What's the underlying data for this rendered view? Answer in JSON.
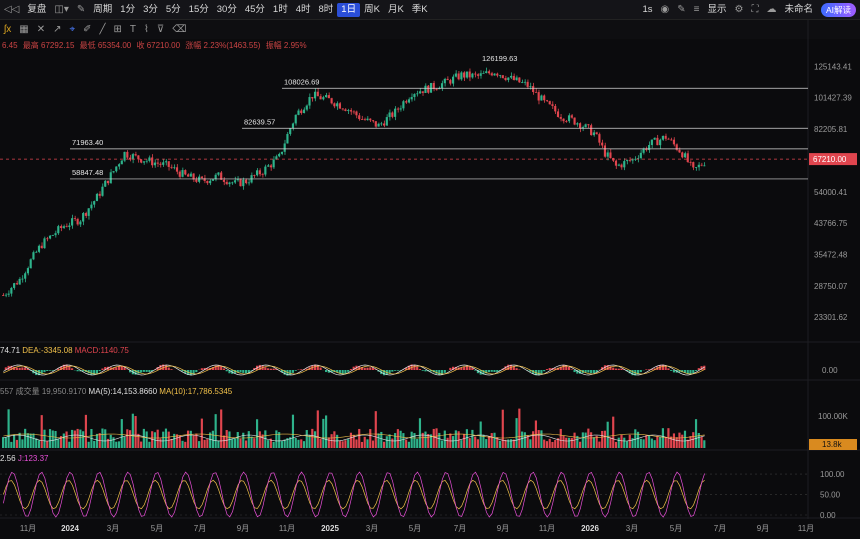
{
  "toolbar": {
    "items": [
      "复盘",
      "周期",
      "1分",
      "3分",
      "5分",
      "15分",
      "30分",
      "45分",
      "1时",
      "4时",
      "8时",
      "1日",
      "周K",
      "月K",
      "季K"
    ],
    "active": "1日",
    "right": {
      "interval": "1s",
      "display": "显示",
      "save": "未命名",
      "ai": "AI解读"
    }
  },
  "info": {
    "items": [
      "6.45",
      "最高 67292.15",
      "最低 65354.00",
      "收 67210.00",
      "涨幅 2.23%(1463.55)",
      "振幅 2.95%"
    ]
  },
  "macd_info": {
    "dif": "74.71",
    "dea": "DEA:-3345.08",
    "macd": "MACD:1140.75"
  },
  "vol_info": {
    "a": "557",
    "b": "成交量 19,950.9170",
    "ma5": "MA(5):14,153.8660",
    "ma10": "MA(10):17,786.5345"
  },
  "kdj_info": {
    "k": "2.56",
    "j": "J:123.37"
  },
  "colors": {
    "up": "#2eb38b",
    "down": "#e0454e",
    "k": "#f0c04a",
    "d": "#e84fd8",
    "price": "#e0454e"
  },
  "chart_data": {
    "type": "candlestick",
    "price_axis": [
      "125143.41",
      "101427.39",
      "82205.81",
      "67210.00",
      "54000.41",
      "43766.75",
      "35472.48",
      "28750.07",
      "23301.62"
    ],
    "last_price": "67210.00",
    "annotations": [
      {
        "label": "126199.63",
        "value": 126199.63
      },
      {
        "label": "108026.69",
        "value": 108026.69
      },
      {
        "label": "82639.57",
        "value": 82639.57
      },
      {
        "label": "71963.40",
        "value": 71963.4
      },
      {
        "label": "58847.48",
        "value": 58847.48
      }
    ],
    "x_ticks": [
      "11月",
      "2024",
      "3月",
      "5月",
      "7月",
      "9月",
      "11月",
      "2025",
      "3月",
      "5月",
      "7月",
      "9月",
      "11月",
      "2026",
      "3月",
      "5月",
      "7月",
      "9月",
      "11月"
    ],
    "macd_axis": [
      "0.00"
    ],
    "volume_axis": [
      "100.00K",
      "13.8k"
    ],
    "kdj_axis": [
      "100.00",
      "50.00",
      "0.00"
    ],
    "trend": [
      [
        0,
        27000
      ],
      [
        6,
        30000
      ],
      [
        14,
        38000
      ],
      [
        22,
        43000
      ],
      [
        28,
        45000
      ],
      [
        34,
        52000
      ],
      [
        40,
        62000
      ],
      [
        44,
        70000
      ],
      [
        48,
        68000
      ],
      [
        54,
        66000
      ],
      [
        60,
        64000
      ],
      [
        66,
        60000
      ],
      [
        72,
        58000
      ],
      [
        78,
        60000
      ],
      [
        84,
        57000
      ],
      [
        88,
        58000
      ],
      [
        94,
        62000
      ],
      [
        100,
        68000
      ],
      [
        106,
        90000
      ],
      [
        112,
        103000
      ],
      [
        118,
        100000
      ],
      [
        124,
        95000
      ],
      [
        130,
        88000
      ],
      [
        136,
        84000
      ],
      [
        142,
        92000
      ],
      [
        148,
        105000
      ],
      [
        154,
        108000
      ],
      [
        160,
        112000
      ],
      [
        166,
        118000
      ],
      [
        172,
        117000
      ],
      [
        178,
        121000
      ],
      [
        184,
        115000
      ],
      [
        190,
        110000
      ],
      [
        196,
        98000
      ],
      [
        202,
        90000
      ],
      [
        208,
        86000
      ],
      [
        214,
        80000
      ],
      [
        218,
        70000
      ],
      [
        222,
        64000
      ],
      [
        228,
        67000
      ],
      [
        234,
        74000
      ],
      [
        240,
        78000
      ],
      [
        246,
        70000
      ],
      [
        250,
        62000
      ],
      [
        254,
        66000
      ]
    ]
  }
}
